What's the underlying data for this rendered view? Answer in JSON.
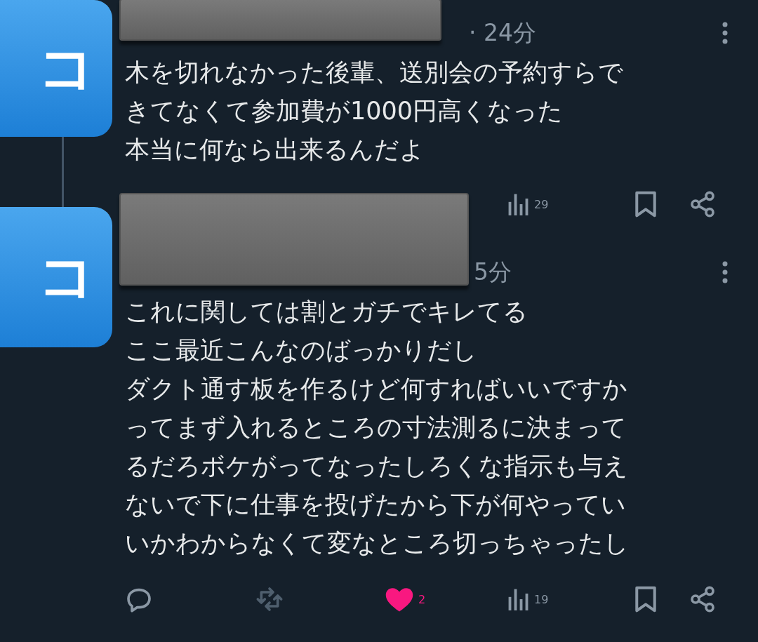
{
  "tweets": [
    {
      "avatar": "コ",
      "time": "· 24分",
      "redacted": true,
      "lines": [
        "木を切れなかった後輩、送別会の予約すらで",
        "きてなくて参加費が1000円高くなった",
        "本当に何なら出来るんだよ"
      ],
      "actions": [
        {
          "kind": "views",
          "count": "29"
        },
        {
          "kind": "bookmark"
        },
        {
          "kind": "share"
        }
      ]
    },
    {
      "avatar": "コ",
      "time": "5分",
      "redacted": true,
      "lines": [
        "これに関しては割とガチでキレてる",
        "ここ最近こんなのばっかりだし",
        "ダクト通す板を作るけど何すればいいですか",
        "ってまず入れるところの寸法測るに決まって",
        "るだろボケがってなったしろくな指示も与え",
        "ないで下に仕事を投げたから下が何やってい",
        "いかわからなくて変なところ切っちゃったし"
      ],
      "actions": [
        {
          "kind": "reply"
        },
        {
          "kind": "retweet"
        },
        {
          "kind": "like",
          "count": "2",
          "liked": true
        },
        {
          "kind": "views",
          "count": "19"
        },
        {
          "kind": "bookmark"
        },
        {
          "kind": "share"
        }
      ]
    }
  ]
}
